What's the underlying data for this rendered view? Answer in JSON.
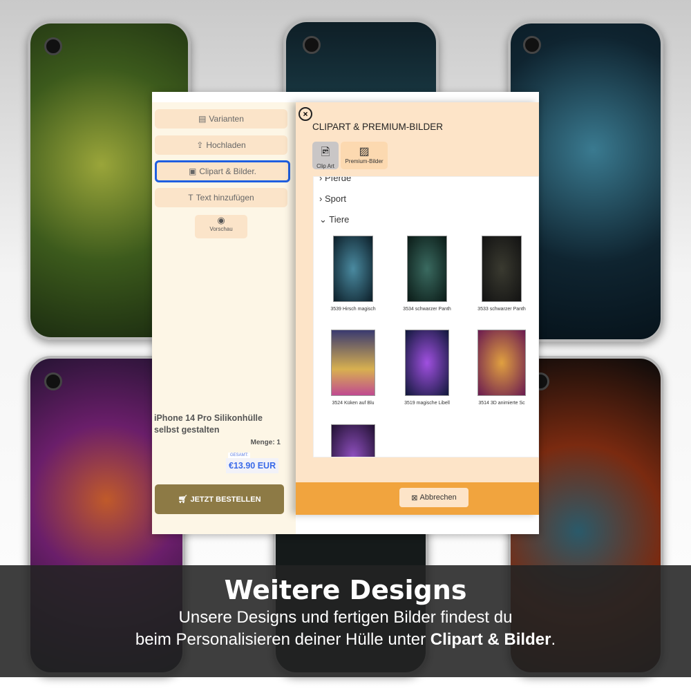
{
  "sidebar": {
    "items": [
      {
        "label": "Varianten",
        "icon": "clipboard-icon"
      },
      {
        "label": "Hochladen",
        "icon": "upload-icon"
      },
      {
        "label": "Clipart & Bilder.",
        "icon": "images-icon"
      },
      {
        "label": "Text hinzufügen",
        "icon": "text-icon"
      }
    ],
    "preview": "Vorschau"
  },
  "product": {
    "title": "iPhone 14 Pro Silikonhülle selbst gestalten",
    "quantity": "Menge: 1",
    "total_label": "GESAMT:",
    "total": "€13.90 EUR",
    "order": "JETZT BESTELLEN"
  },
  "modal": {
    "title": "CLIPART & PREMIUM-BILDER",
    "tabs": [
      "Clip Art",
      "Premium-Bilder"
    ],
    "categories": [
      {
        "label": "Pferde",
        "expanded": false
      },
      {
        "label": "Sport",
        "expanded": false
      },
      {
        "label": "Tiere",
        "expanded": true
      }
    ],
    "images": [
      "3539 Hirsch magisch",
      "3534 schwarzer Panth",
      "3533 schwarzer Panth",
      "3524 Küken auf Blu",
      "3519 magische Libell",
      "3514 3D animierte Sc"
    ],
    "cancel": "Abbrechen"
  },
  "banner": {
    "title": "Weitere Designs",
    "line1": "Unsere Designs und fertigen Bilder findest du",
    "line2": "beim Personalisieren deiner Hülle unter ",
    "line2_bold": "Clipart & Bilder",
    "line2_end": "."
  },
  "colors": {
    "accent_blue": "#1f5fe0",
    "order_button": "#8d7a45",
    "footer": "#f1a43e"
  }
}
